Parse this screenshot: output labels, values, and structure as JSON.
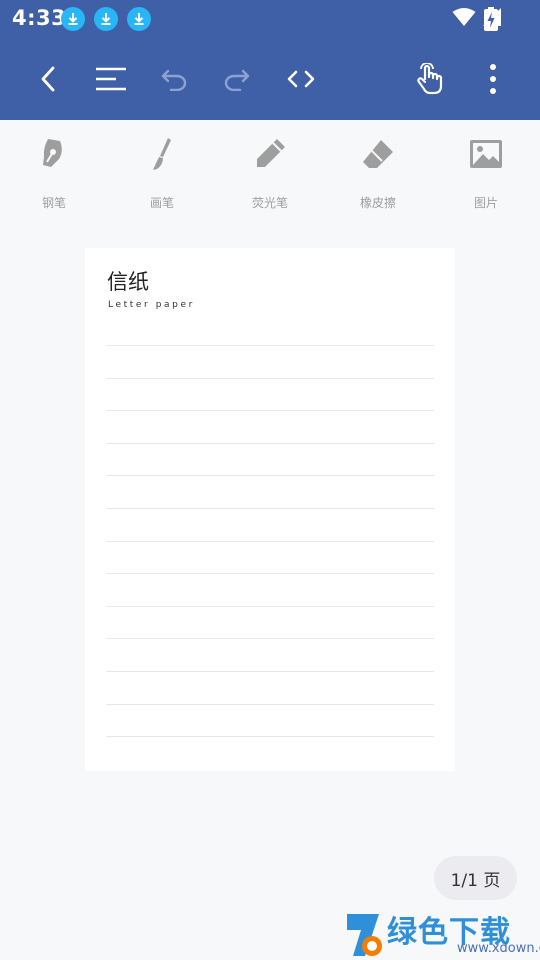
{
  "status": {
    "time": "4:33"
  },
  "toolbar": {
    "back": "back",
    "menu": "menu",
    "undo": "undo",
    "redo": "redo",
    "code": "code",
    "touch": "touch",
    "more": "more"
  },
  "tools": [
    {
      "label": "钢笔",
      "icon": "pen-nib-icon"
    },
    {
      "label": "画笔",
      "icon": "brush-icon"
    },
    {
      "label": "荧光笔",
      "icon": "highlighter-icon"
    },
    {
      "label": "橡皮擦",
      "icon": "eraser-icon"
    },
    {
      "label": "图片",
      "icon": "image-icon"
    }
  ],
  "paper": {
    "title": "信纸",
    "subtitle": "Letter paper"
  },
  "pager": {
    "text": "1/1 页"
  },
  "watermark": {
    "title": "绿色下载站",
    "url": "www.xdown.com"
  },
  "colors": {
    "primary": "#3f5fa6",
    "tool_icon": "#9e9e9e",
    "download_badge": "#29b6f6"
  }
}
